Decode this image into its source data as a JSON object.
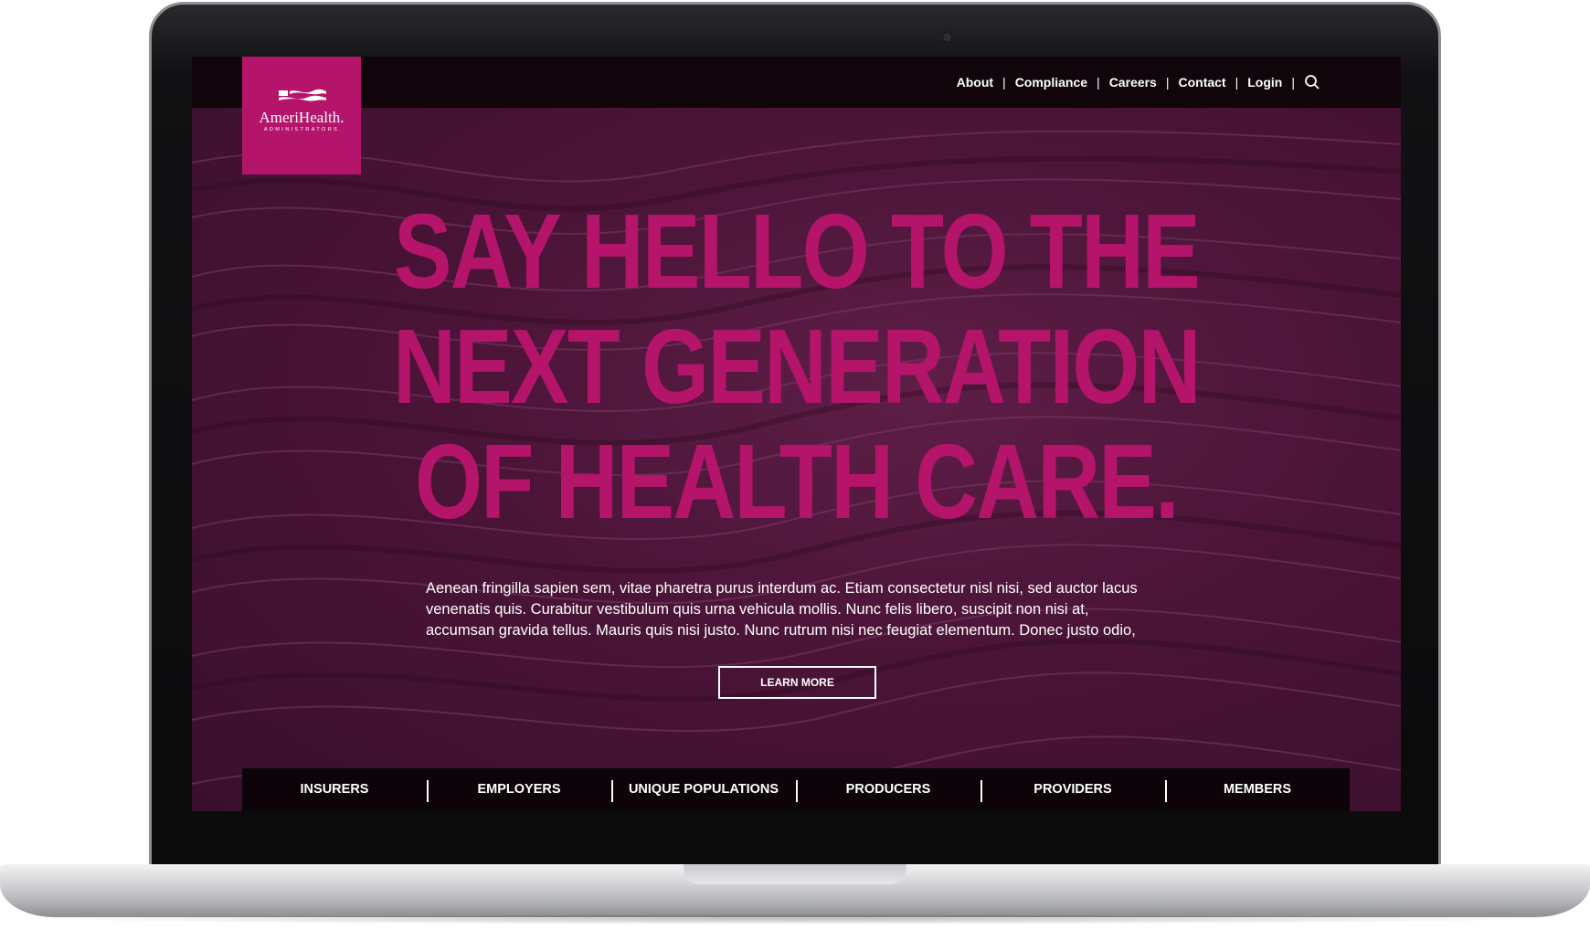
{
  "brand": {
    "name": "AmeriHealth.",
    "subtitle": "ADMINISTRATORS",
    "color": "#b5146b"
  },
  "utility_nav": {
    "items": [
      {
        "label": "About"
      },
      {
        "label": "Compliance"
      },
      {
        "label": "Careers"
      },
      {
        "label": "Contact"
      },
      {
        "label": "Login"
      }
    ],
    "search_icon": "search-icon"
  },
  "hero": {
    "headline_lines": [
      "SAY HELLO TO THE",
      "NEXT GENERATION",
      "OF HEALTH CARE."
    ],
    "body_lines": [
      "Aenean fringilla sapien sem, vitae pharetra purus interdum ac. Etiam consectetur nisl nisi, sed auctor lacus",
      "venenatis quis. Curabitur vestibulum quis urna vehicula mollis. Nunc felis libero, suscipit non nisi at,",
      "accumsan gravida tellus. Mauris quis nisi justo. Nunc rutrum nisi nec feugiat elementum. Donec justo odio,"
    ],
    "cta_label": "LEARN MORE"
  },
  "audience_nav": {
    "items": [
      {
        "label": "INSURERS"
      },
      {
        "label": "EMPLOYERS"
      },
      {
        "label": "UNIQUE POPULATIONS"
      },
      {
        "label": "PRODUCERS"
      },
      {
        "label": "PROVIDERS"
      },
      {
        "label": "MEMBERS"
      }
    ]
  },
  "colors": {
    "accent": "#b5146b",
    "hero_background": "#4a1437",
    "bar_background": "#0c0409"
  }
}
